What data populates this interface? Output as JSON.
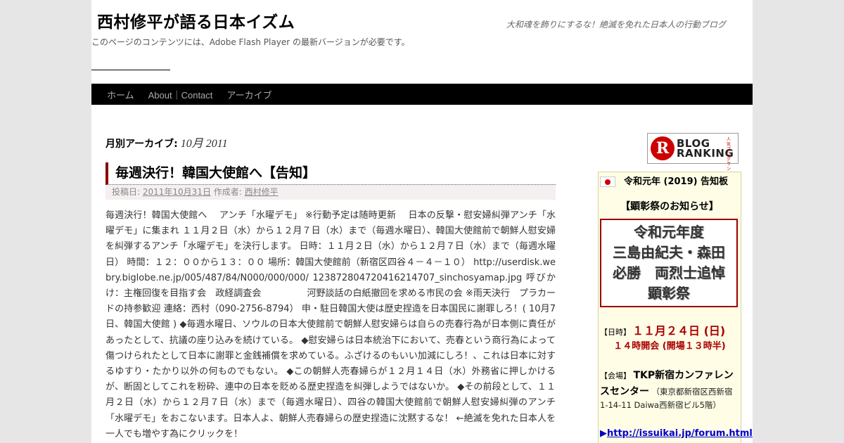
{
  "header": {
    "site_title": "西村修平が語る日本イズム",
    "site_description": "大和魂を飾りにするな！絶滅を免れた日本人の行動ブログ",
    "flash_message": "このページのコンテンツには、Adobe Flash Player の最新バージョンが必要です。"
  },
  "nav": {
    "items": [
      {
        "label": "ホーム"
      },
      {
        "label": "About｜Contact"
      },
      {
        "label": "アーカイブ"
      }
    ]
  },
  "archive": {
    "label": "月別アーカイブ:",
    "month": "10月 2011"
  },
  "post": {
    "title": "毎週決行！韓国大使館へ【告知】",
    "meta_posted": "投稿日:",
    "meta_date": "2011年10月31日",
    "meta_author_label": "作成者:",
    "meta_author": "西村修平",
    "body": "毎週決行！韓国大使館へ　 アンチ「水曜デモ」 ※行動予定は随時更新　 日本の反撃・慰安婦糾弾アンチ「水曜デモ」に集まれ １１月２日（水）から１２月７日（水）まで（毎週水曜日）、韓国大使館前で朝鮮人慰安婦を糾弾するアンチ「水曜デモ」を決行します。 日時：１１月２日（水）から１２月７日（水）まで（毎週水曜日） 時間：１２：００から１３：００ 場所：韓国大使館前（新宿区四谷４－４－１０） http://userdisk.webry.biglobe.ne.jp/005/487/84/N000/000/000/ 123872804720416214707_sinchosyamap.jpg 呼びかけ：主権回復を目指す会　政経調査会　　　　　河野談話の白紙撤回を求める市民の会 ※雨天決行　プラカードの持参歓迎 連絡：西村（090-2756-8794） 申・駐日韓国大使は歴史捏造を日本国民に謝罪しろ！( 10月7日、韓国大使館 ) ◆毎週水曜日、ソウルの日本大使館前で朝鮮人慰安婦らは自らの売春行為が日本側に責任があったとして、抗議の座り込みを続けている。 ◆慰安婦らは日本統治下において、売春という商行為によって傷つけられたとして日本に謝罪と金銭補償を求めている。ふざけるのもいい加減にしろ！、これは日本に対するゆすり・たかり以外の何ものでもない。 ◆この朝鮮人売春婦らが１２月１４日（水）外務省に押しかけるが、断固としてこれを粉砕、連中の日本を貶める歴史捏造を糾弾しようではないか。 ◆その前段として、１１月２日（水）から１２月７日（水）まで（毎週水曜日）、四谷の韓国大使館前で朝鮮人慰安婦糾弾のアンチ「水曜デモ」をおこないます。日本人よ、朝鮮人売春婦らの歴史捏造に沈黙するな！ ←絶滅を免れた日本人を一人でも増やす為にクリックを！"
  },
  "sidebar": {
    "blog_ranking": {
      "letter": "R",
      "line1": "BLOG",
      "line2": "RANKING",
      "small": "人気ブログランキング"
    },
    "notice": {
      "heading": "令和元年 (2019) 告知板",
      "subheading": "【顕彰祭のお知らせ】",
      "event_lines": [
        "令和元年度",
        "三島由紀夫・森田",
        "必勝　両烈士追悼",
        "顕彰祭"
      ],
      "date_label": "【日時】",
      "date_value": "１１月２４日 (日)",
      "time_value": "１４時開会 (開場１３時半)",
      "venue_label": "【会場】",
      "venue_name": "TKP新宿カンファレンスセンター",
      "venue_address_1": "（東京都新宿区西新宿",
      "venue_address_2": "1-14-11 Daiwa西新宿ビル5階）",
      "link_marker": "▶",
      "link_text": "http://issuikai.jp/forum.html"
    }
  }
}
